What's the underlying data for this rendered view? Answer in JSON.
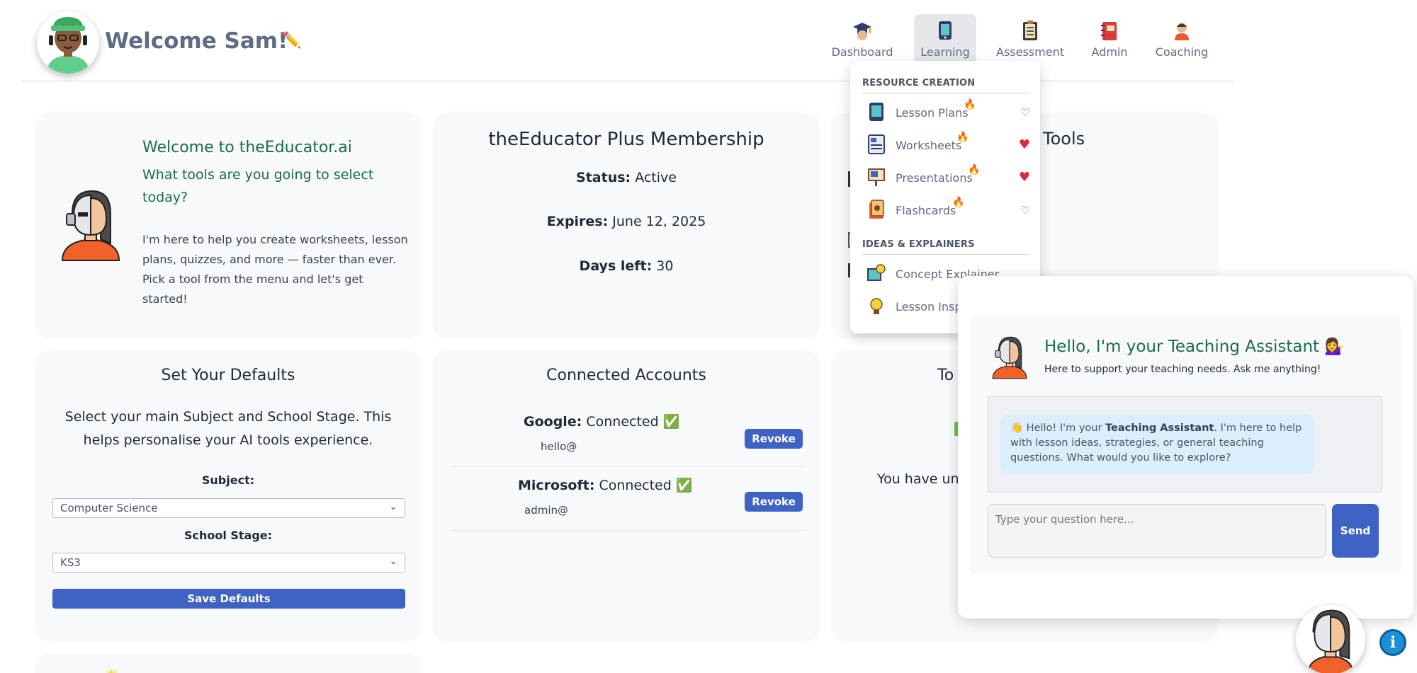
{
  "header": {
    "welcome": "Welcome Sam!",
    "nav": [
      {
        "label": "Dashboard",
        "icon": "graduation-cap-icon"
      },
      {
        "label": "Learning",
        "icon": "tablet-icon",
        "active": true
      },
      {
        "label": "Assessment",
        "icon": "clipboard-icon"
      },
      {
        "label": "Admin",
        "icon": "binder-icon"
      },
      {
        "label": "Coaching",
        "icon": "coach-icon"
      }
    ]
  },
  "welcome_card": {
    "title": "Welcome to theEducator.ai",
    "subtitle": "What tools are you going to select today?",
    "body": "I'm here to help you create worksheets, lesson plans, quizzes, and more — faster than ever. Pick a tool from the menu and let's get started!"
  },
  "membership": {
    "title": "theEducator Plus Membership",
    "status_label": "Status:",
    "status_value": "Active",
    "expires_label": "Expires:",
    "expires_value": "June 12, 2025",
    "days_label": "Days left:",
    "days_value": "30"
  },
  "tools_card": {
    "title_fragment": "Tools"
  },
  "defaults": {
    "title": "Set Your Defaults",
    "description": "Select your main Subject and School Stage. This helps personalise your AI tools experience.",
    "subject_label": "Subject:",
    "subject_value": "Computer Science",
    "stage_label": "School Stage:",
    "stage_value": "KS3",
    "save_label": "Save Defaults"
  },
  "accounts": {
    "title": "Connected Accounts",
    "items": [
      {
        "provider": "Google:",
        "status": "Connected ✅",
        "email": "hello@",
        "button": "Revoke"
      },
      {
        "provider": "Microsoft:",
        "status": "Connected ✅",
        "email": "admin@",
        "button": "Revoke"
      }
    ]
  },
  "tokens_card": {
    "title_fragment": "To",
    "text_fragment": "You have unl"
  },
  "dropdown": {
    "section1": "RESOURCE CREATION",
    "items1": [
      {
        "label": "Lesson Plans",
        "fav": false
      },
      {
        "label": "Worksheets",
        "fav": true
      },
      {
        "label": "Presentations",
        "fav": true
      },
      {
        "label": "Flashcards",
        "fav": false
      }
    ],
    "section2": "IDEAS & EXPLAINERS",
    "items2": [
      {
        "label": "Concept Explainer"
      },
      {
        "label": "Lesson Inspi"
      }
    ]
  },
  "assistant": {
    "title": "Hello, I'm your Teaching Assistant 💁‍♀️",
    "subtitle": "Here to support your teaching needs. Ask me anything!",
    "msg_intro": "👋 Hello! I'm your ",
    "msg_bold": "Teaching Assistant",
    "msg_rest": ". I'm here to help with lesson ideas, strategies, or general teaching questions. What would you like to explore?",
    "placeholder": "Type your question here...",
    "send": "Send"
  },
  "bottom_card": {
    "fragment": "🌟"
  },
  "colors": {
    "accent_blue": "#3f63c5",
    "heading_green": "#1b6b4e",
    "heart_red": "#e0263a"
  }
}
